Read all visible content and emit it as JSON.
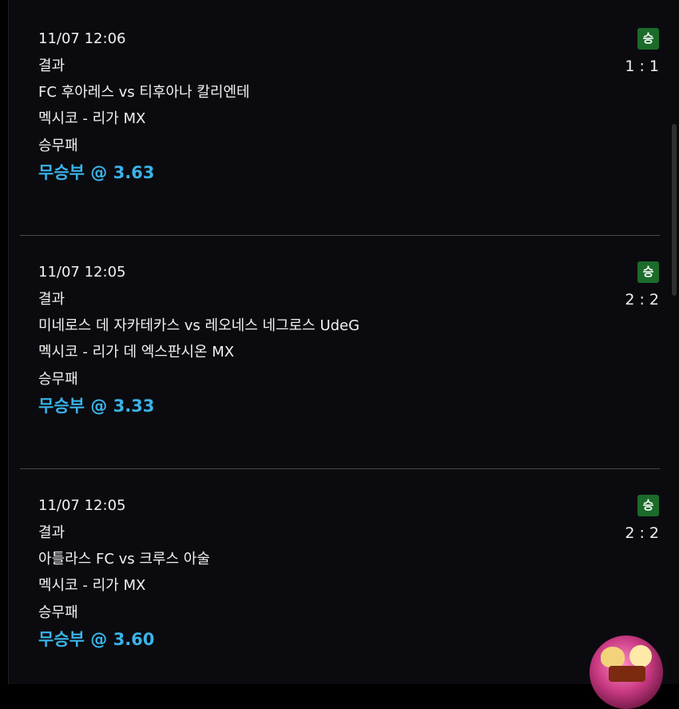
{
  "colors": {
    "background": "#000000",
    "panel": "#0b0b0f",
    "pick_text": "#3ab3e8",
    "win_badge": "#1b6b2a",
    "divider": "#4a4a4f"
  },
  "bets": [
    {
      "datetime": "11/07 12:06",
      "market": "결과",
      "match": "FC 후아레스 vs 티후아나 칼리엔테",
      "league": "멕시코 - 리가 MX",
      "bet_type": "승무패",
      "pick": "무승부 @ 3.63",
      "status": "승",
      "score": "1 : 1"
    },
    {
      "datetime": "11/07 12:05",
      "market": "결과",
      "match": "미네로스 데 자카테카스 vs 레오네스 네그로스 UdeG",
      "league": "멕시코 - 리가 데 엑스판시온 MX",
      "bet_type": "승무패",
      "pick": "무승부 @ 3.33",
      "status": "승",
      "score": "2 : 2"
    },
    {
      "datetime": "11/07 12:05",
      "market": "결과",
      "match": "아틀라스 FC vs 크루스 아술",
      "league": "멕시코 - 리가 MX",
      "bet_type": "승무패",
      "pick": "무승부 @ 3.60",
      "status": "승",
      "score": "2 : 2"
    }
  ],
  "mascot_icon": "mascot-logo-icon"
}
